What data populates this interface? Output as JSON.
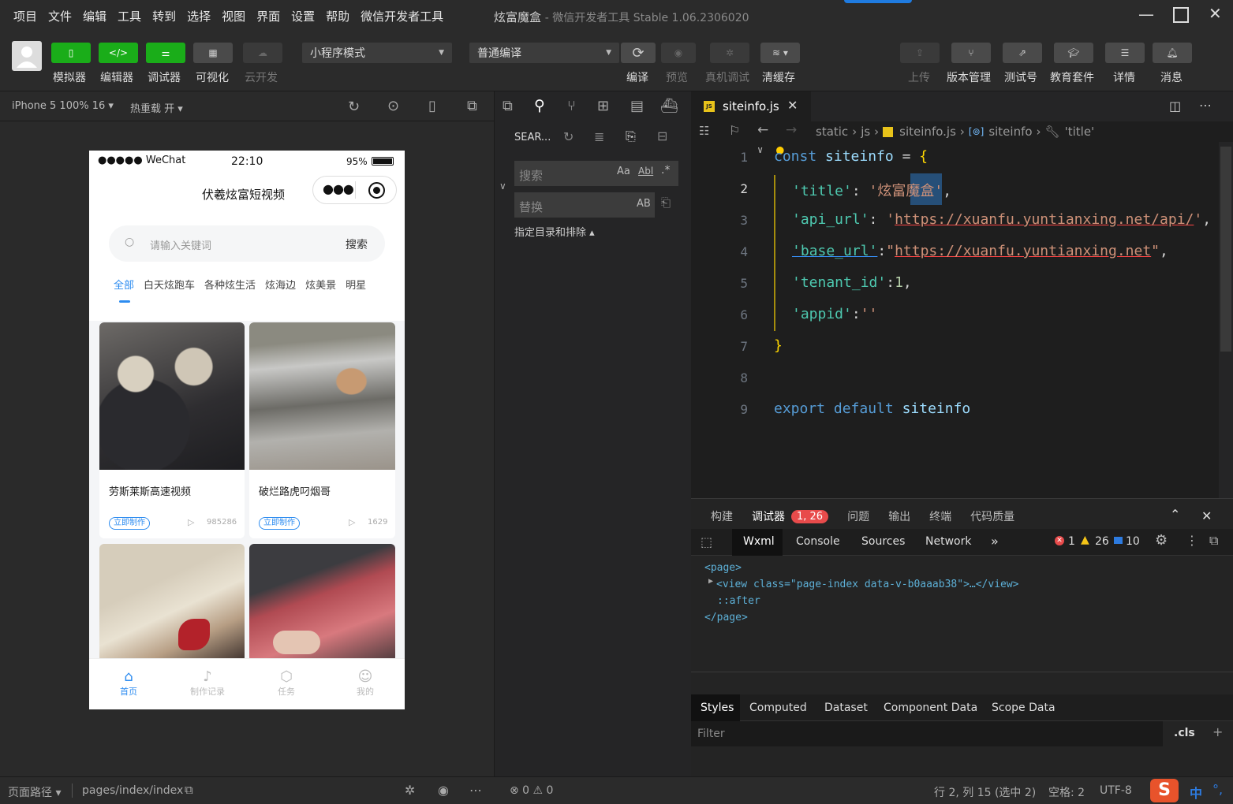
{
  "menubar": {
    "items": [
      "项目",
      "文件",
      "编辑",
      "工具",
      "转到",
      "选择",
      "视图",
      "界面",
      "设置",
      "帮助",
      "微信开发者工具"
    ],
    "title": "炫富魔盒",
    "subtitle": "- 微信开发者工具 Stable 1.06.2306020"
  },
  "toolbar": {
    "simulator": "模拟器",
    "editor": "编辑器",
    "debugger": "调试器",
    "visual": "可视化",
    "cloud": "云开发",
    "mode_select": "小程序模式",
    "compile_select": "普通编译",
    "compile": "编译",
    "preview": "预览",
    "remote_debug": "真机调试",
    "clear_cache": "清缓存",
    "upload": "上传",
    "version": "版本管理",
    "test_account": "测试号",
    "education": "教育套件",
    "details": "详情",
    "messages": "消息"
  },
  "sim_bar": {
    "device": "iPhone 5 100% 16",
    "hot_reload": "热重载 开"
  },
  "phone": {
    "carrier": "●●●●● WeChat",
    "time": "22:10",
    "battery": "95%",
    "nav_title": "伏羲炫富短视频",
    "search_placeholder": "请输入关键词",
    "search_button": "搜索",
    "categories": [
      "全部",
      "白天炫跑车",
      "各种炫生活",
      "炫海边",
      "炫美景",
      "明星"
    ],
    "cards": [
      {
        "title": "劳斯莱斯高速视频",
        "tag": "立即制作",
        "plays": "985286"
      },
      {
        "title": "破烂路虎叼烟哥",
        "tag": "立即制作",
        "plays": "1629"
      }
    ],
    "tabbar": [
      "首页",
      "制作记录",
      "任务",
      "我的"
    ]
  },
  "search_panel": {
    "title": "SEAR...",
    "search_placeholder": "搜索",
    "replace_placeholder": "替换",
    "match_case": "Aa",
    "whole_word": "Abl",
    "regex": ".*",
    "preserve_case": "AB",
    "include_exclude": "指定目录和排除 ▴"
  },
  "editor": {
    "tab": "siteinfo.js",
    "breadcrumb": [
      "static",
      "js",
      "siteinfo.js",
      "siteinfo",
      "'title'"
    ],
    "line_numbers": [
      "1",
      "2",
      "3",
      "4",
      "5",
      "6",
      "7",
      "8",
      "9"
    ]
  },
  "devtools": {
    "tabs": [
      "构建",
      "调试器",
      "问题",
      "输出",
      "终端",
      "代码质量"
    ],
    "badge": "1, 26",
    "subtabs": [
      "Wxml",
      "Console",
      "Sources",
      "Network"
    ],
    "errors": "1",
    "warnings": "26",
    "infos": "10",
    "tree": [
      "<page>",
      "<view class=\"page-index data-v-b0aaab38\">…</view>",
      "::after",
      "</page>"
    ],
    "style_tabs": [
      "Styles",
      "Computed",
      "Dataset",
      "Component Data",
      "Scope Data"
    ],
    "filter_placeholder": "Filter",
    "cls": ".cls"
  },
  "statusbar": {
    "page_path_label": "页面路径",
    "page_path": "pages/index/index",
    "problems": "⊗ 0 ⚠ 0",
    "cursor": "行 2, 列 15 (选中 2)",
    "spaces": "空格: 2",
    "encoding": "UTF-8",
    "ime": "中"
  }
}
